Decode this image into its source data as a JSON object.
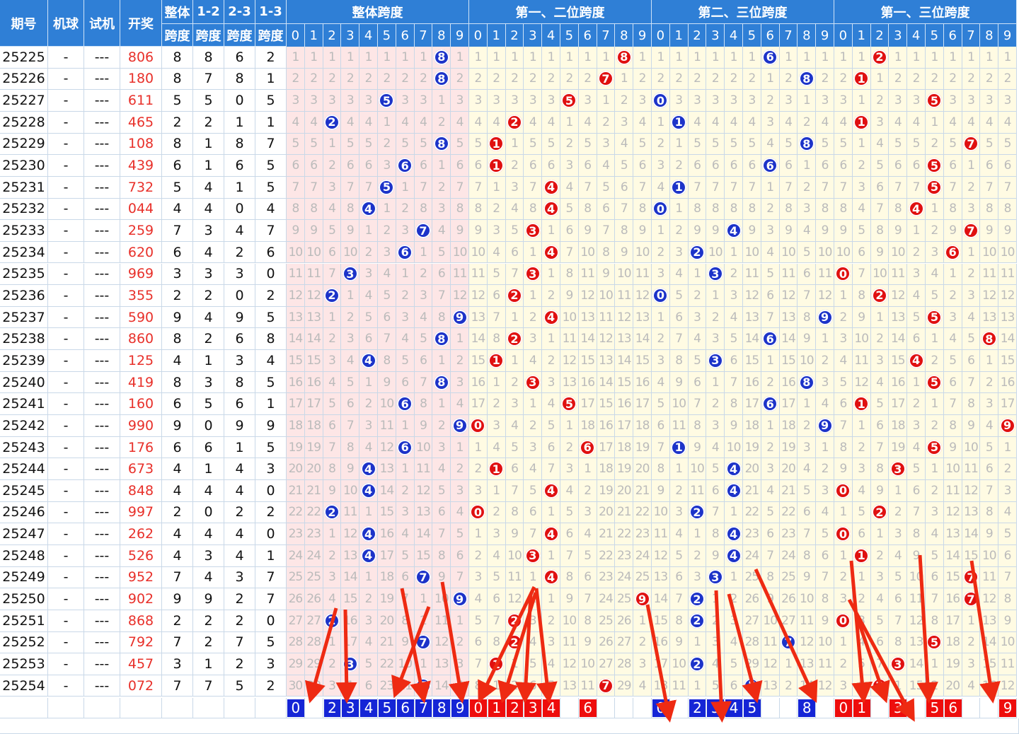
{
  "headers": {
    "period": "期号",
    "machine": "机球",
    "tester": "试机",
    "draw": "开奖",
    "span_overall": [
      "整体",
      "跨度"
    ],
    "span_12": [
      "1-2",
      "跨度"
    ],
    "span_23": [
      "2-3",
      "跨度"
    ],
    "span_13": [
      "1-3",
      "跨度"
    ],
    "groups": [
      "整体跨度",
      "第一、二位跨度",
      "第二、三位跨度",
      "第一、三位跨度"
    ],
    "digits": [
      "0",
      "1",
      "2",
      "3",
      "4",
      "5",
      "6",
      "7",
      "8",
      "9"
    ]
  },
  "colors": {
    "blue": "#1c33c9",
    "red": "#e01010",
    "header": "#2f7fd6",
    "pink": "#fde6e6",
    "cream": "#fffbe3",
    "arrow": "#ee2a12"
  },
  "chart_data": {
    "type": "table",
    "rows": [
      {
        "period": "25225",
        "machine": "-",
        "tester": "---",
        "draw": "806",
        "s": 8,
        "s12": 8,
        "s23": 6,
        "s13": 2
      },
      {
        "period": "25226",
        "machine": "-",
        "tester": "---",
        "draw": "180",
        "s": 8,
        "s12": 7,
        "s23": 8,
        "s13": 1
      },
      {
        "period": "25227",
        "machine": "-",
        "tester": "---",
        "draw": "611",
        "s": 5,
        "s12": 5,
        "s23": 0,
        "s13": 5
      },
      {
        "period": "25228",
        "machine": "-",
        "tester": "---",
        "draw": "465",
        "s": 2,
        "s12": 2,
        "s23": 1,
        "s13": 1
      },
      {
        "period": "25229",
        "machine": "-",
        "tester": "---",
        "draw": "108",
        "s": 8,
        "s12": 1,
        "s23": 8,
        "s13": 7
      },
      {
        "period": "25230",
        "machine": "-",
        "tester": "---",
        "draw": "439",
        "s": 6,
        "s12": 1,
        "s23": 6,
        "s13": 5
      },
      {
        "period": "25231",
        "machine": "-",
        "tester": "---",
        "draw": "732",
        "s": 5,
        "s12": 4,
        "s23": 1,
        "s13": 5
      },
      {
        "period": "25232",
        "machine": "-",
        "tester": "---",
        "draw": "044",
        "s": 4,
        "s12": 4,
        "s23": 0,
        "s13": 4
      },
      {
        "period": "25233",
        "machine": "-",
        "tester": "---",
        "draw": "259",
        "s": 7,
        "s12": 3,
        "s23": 4,
        "s13": 7
      },
      {
        "period": "25234",
        "machine": "-",
        "tester": "---",
        "draw": "620",
        "s": 6,
        "s12": 4,
        "s23": 2,
        "s13": 6
      },
      {
        "period": "25235",
        "machine": "-",
        "tester": "---",
        "draw": "969",
        "s": 3,
        "s12": 3,
        "s23": 3,
        "s13": 0
      },
      {
        "period": "25236",
        "machine": "-",
        "tester": "---",
        "draw": "355",
        "s": 2,
        "s12": 2,
        "s23": 0,
        "s13": 2
      },
      {
        "period": "25237",
        "machine": "-",
        "tester": "---",
        "draw": "590",
        "s": 9,
        "s12": 4,
        "s23": 9,
        "s13": 5
      },
      {
        "period": "25238",
        "machine": "-",
        "tester": "---",
        "draw": "860",
        "s": 8,
        "s12": 2,
        "s23": 6,
        "s13": 8
      },
      {
        "period": "25239",
        "machine": "-",
        "tester": "---",
        "draw": "125",
        "s": 4,
        "s12": 1,
        "s23": 3,
        "s13": 4
      },
      {
        "period": "25240",
        "machine": "-",
        "tester": "---",
        "draw": "419",
        "s": 8,
        "s12": 3,
        "s23": 8,
        "s13": 5
      },
      {
        "period": "25241",
        "machine": "-",
        "tester": "---",
        "draw": "160",
        "s": 6,
        "s12": 5,
        "s23": 6,
        "s13": 1
      },
      {
        "period": "25242",
        "machine": "-",
        "tester": "---",
        "draw": "990",
        "s": 9,
        "s12": 0,
        "s23": 9,
        "s13": 9
      },
      {
        "period": "25243",
        "machine": "-",
        "tester": "---",
        "draw": "176",
        "s": 6,
        "s12": 6,
        "s23": 1,
        "s13": 5
      },
      {
        "period": "25244",
        "machine": "-",
        "tester": "---",
        "draw": "673",
        "s": 4,
        "s12": 1,
        "s23": 4,
        "s13": 3
      },
      {
        "period": "25245",
        "machine": "-",
        "tester": "---",
        "draw": "848",
        "s": 4,
        "s12": 4,
        "s23": 4,
        "s13": 0
      },
      {
        "period": "25246",
        "machine": "-",
        "tester": "---",
        "draw": "997",
        "s": 2,
        "s12": 0,
        "s23": 2,
        "s13": 2
      },
      {
        "period": "25247",
        "machine": "-",
        "tester": "---",
        "draw": "262",
        "s": 4,
        "s12": 4,
        "s23": 4,
        "s13": 0
      },
      {
        "period": "25248",
        "machine": "-",
        "tester": "---",
        "draw": "526",
        "s": 4,
        "s12": 3,
        "s23": 4,
        "s13": 1
      },
      {
        "period": "25249",
        "machine": "-",
        "tester": "---",
        "draw": "952",
        "s": 7,
        "s12": 4,
        "s23": 3,
        "s13": 7
      },
      {
        "period": "25250",
        "machine": "-",
        "tester": "---",
        "draw": "902",
        "s": 9,
        "s12": 9,
        "s23": 2,
        "s13": 7
      },
      {
        "period": "25251",
        "machine": "-",
        "tester": "---",
        "draw": "868",
        "s": 2,
        "s12": 2,
        "s23": 2,
        "s13": 0
      },
      {
        "period": "25252",
        "machine": "-",
        "tester": "---",
        "draw": "792",
        "s": 7,
        "s12": 2,
        "s23": 7,
        "s13": 5
      },
      {
        "period": "25253",
        "machine": "-",
        "tester": "---",
        "draw": "457",
        "s": 3,
        "s12": 1,
        "s23": 2,
        "s13": 3
      },
      {
        "period": "25254",
        "machine": "-",
        "tester": "---",
        "draw": "072",
        "s": 7,
        "s12": 7,
        "s23": 5,
        "s13": 2
      }
    ],
    "predictions": {
      "overall": [
        0,
        2,
        3,
        4,
        5,
        6,
        7,
        8,
        9
      ],
      "s12": [
        0,
        1,
        2,
        3,
        4,
        6
      ],
      "s23": [
        0,
        2,
        3,
        4,
        5,
        8
      ],
      "s13": [
        0,
        1,
        3,
        5,
        6,
        9
      ]
    }
  }
}
